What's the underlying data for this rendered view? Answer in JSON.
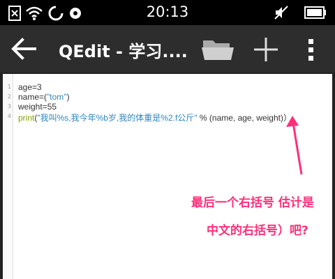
{
  "status_bar": {
    "time": "20:13",
    "icons": [
      "sim-off-icon",
      "wifi-icon",
      "loading-circle-icon",
      "disc-icon",
      "mute-icon",
      "battery-icon"
    ]
  },
  "action_bar": {
    "title": "QEdit - 学习....",
    "back_icon": "arrow-left-icon",
    "folder_icon": "folder-icon",
    "add_icon": "plus-icon",
    "menu_icon": "vertical-dots-icon"
  },
  "editor": {
    "line_numbers": [
      "1",
      "2",
      "3",
      "4"
    ],
    "lines": [
      {
        "parts": [
          {
            "text": "age=3",
            "style": "plain"
          }
        ]
      },
      {
        "parts": [
          {
            "text": "name=(",
            "style": "plain"
          },
          {
            "text": "\"tom\"",
            "style": "str"
          },
          {
            "text": ")",
            "style": "plain"
          }
        ]
      },
      {
        "parts": [
          {
            "text": "weight=55",
            "style": "plain"
          }
        ]
      },
      {
        "parts": [
          {
            "text": "print",
            "style": "kw"
          },
          {
            "text": "(",
            "style": "plain"
          },
          {
            "text": "\"我叫%s,我今年%b岁,我的体重是%2.f公斤\"",
            "style": "str"
          },
          {
            "text": " % (name, age, weight)",
            "style": "plain"
          },
          {
            "text": "）",
            "style": "plain"
          }
        ]
      }
    ]
  },
  "annotation": {
    "line1": "最后一个右括号 估计是",
    "line2": "中文的右括号）吧?",
    "color": "#ff2f7a"
  }
}
